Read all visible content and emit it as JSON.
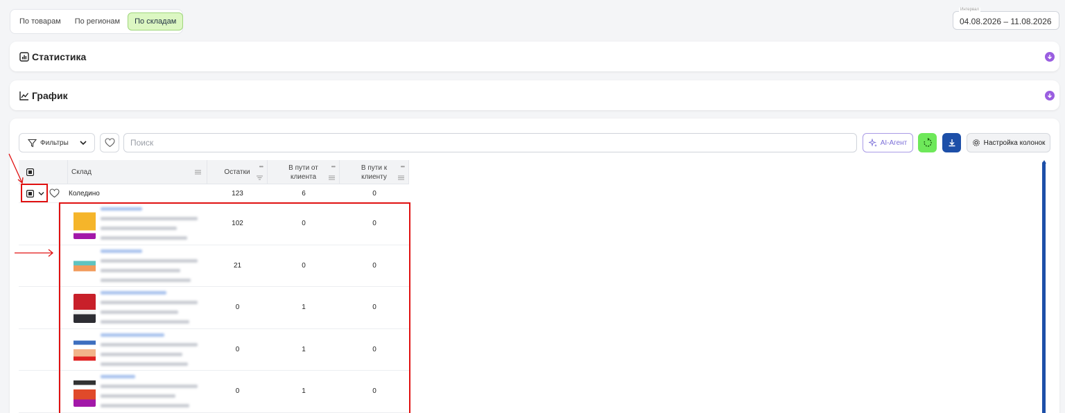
{
  "view_tabs": [
    {
      "label": "По товарам",
      "active": false
    },
    {
      "label": "По регионам",
      "active": false
    },
    {
      "label": "По складам",
      "active": true
    }
  ],
  "period": {
    "label": "Интервал",
    "value": "04.08.2026 – 11.08.2026"
  },
  "sections": {
    "statistics": "Статистика",
    "chart": "График"
  },
  "toolbar": {
    "filters_label": "Фильтры",
    "search_placeholder": "Поиск",
    "ai_label": "AI-Агент",
    "columns_label": "Настройка колонок"
  },
  "table": {
    "headers": {
      "warehouse": "Склад",
      "stock": "Остатки",
      "from_client": "В пути от клиента",
      "to_client": "В пути к клиенту"
    },
    "group_row": {
      "warehouse": "Коледино",
      "stock": "123",
      "from_client": "6",
      "to_client": "0"
    },
    "product_rows": [
      {
        "stock": "102",
        "from_client": "0",
        "to_client": "0"
      },
      {
        "stock": "21",
        "from_client": "0",
        "to_client": "0"
      },
      {
        "stock": "0",
        "from_client": "1",
        "to_client": "0"
      },
      {
        "stock": "0",
        "from_client": "1",
        "to_client": "0"
      },
      {
        "stock": "0",
        "from_client": "1",
        "to_client": "0"
      }
    ]
  },
  "colors": {
    "accent_purple": "#9a5ee0",
    "active_tab": "#dcf7c2",
    "refresh_green": "#6ee85a",
    "download_blue": "#1d4fa8",
    "annotation_red": "#e01010"
  }
}
